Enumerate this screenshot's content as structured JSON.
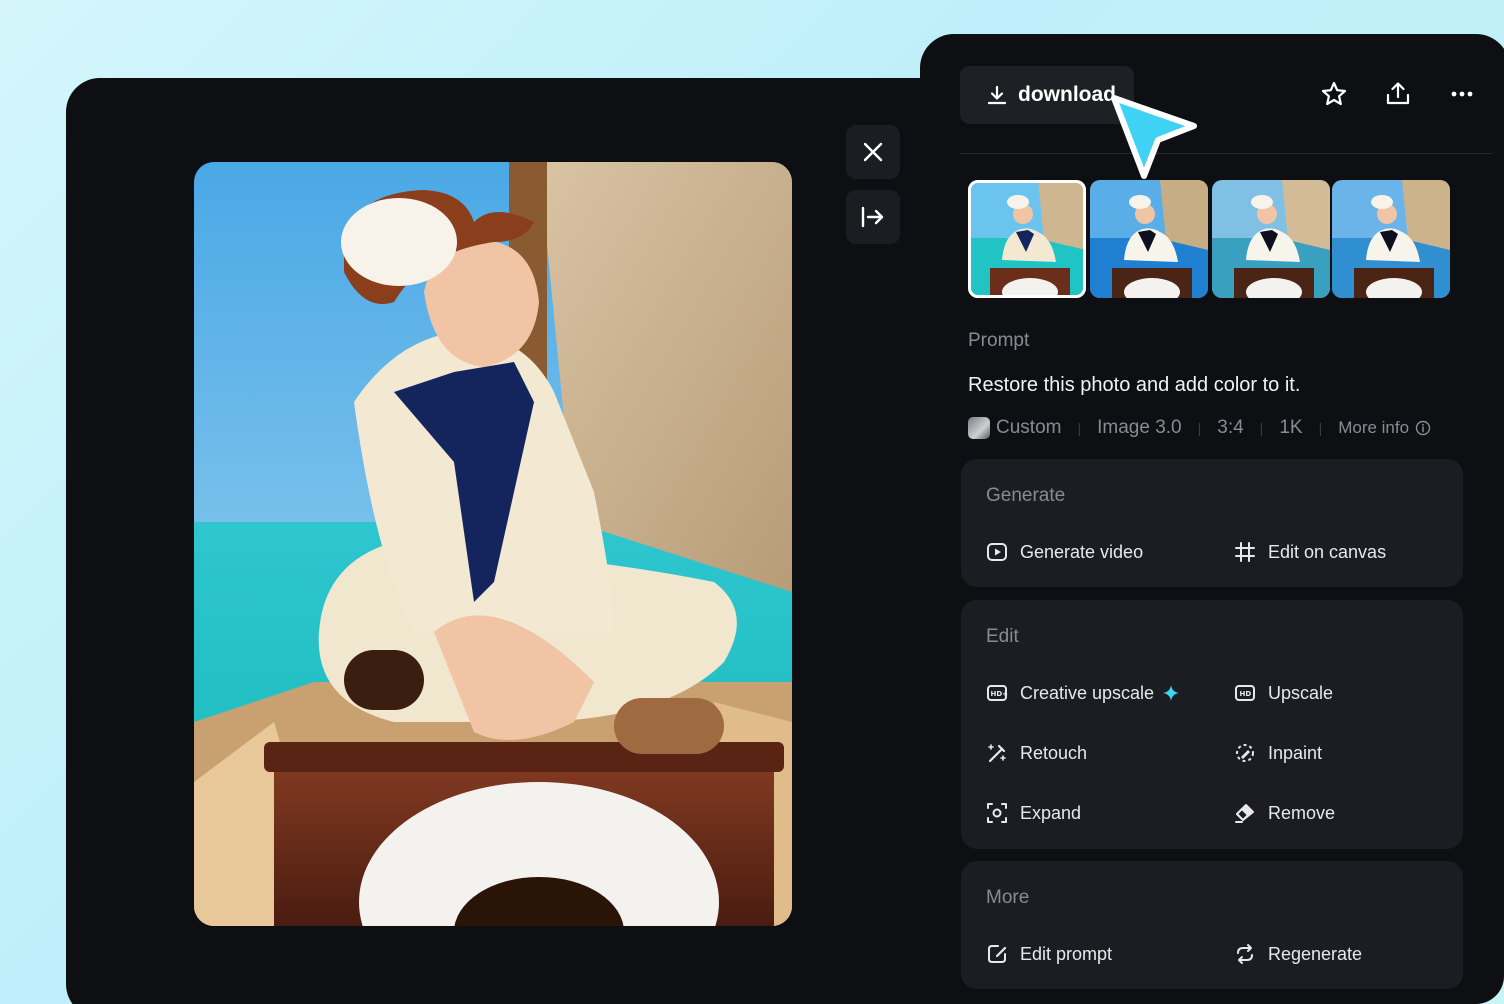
{
  "header": {
    "download_label": "download",
    "icons": [
      "star-icon",
      "share-icon",
      "more-icon"
    ]
  },
  "thumbnails": [
    {
      "selected": true,
      "sea": "#20c4c4",
      "sky": "#6bc4ee"
    },
    {
      "selected": false,
      "sea": "#1f7fd0",
      "sky": "#5aaee8"
    },
    {
      "selected": false,
      "sea": "#3aa0c0",
      "sky": "#80c0e4"
    },
    {
      "selected": false,
      "sea": "#2f8fd0",
      "sky": "#6ab4ea"
    }
  ],
  "prompt": {
    "label": "Prompt",
    "text": "Restore this photo and add color to it."
  },
  "meta": {
    "style": "Custom",
    "model": "Image 3.0",
    "ratio": "3:4",
    "resolution": "1K",
    "more_info": "More info"
  },
  "sections": {
    "generate": {
      "title": "Generate",
      "items": [
        "Generate video",
        "Edit on canvas"
      ]
    },
    "edit": {
      "title": "Edit",
      "items": [
        "Creative upscale",
        "Upscale",
        "Retouch",
        "Inpaint",
        "Expand",
        "Remove"
      ]
    },
    "more": {
      "title": "More",
      "items": [
        "Edit prompt",
        "Regenerate"
      ]
    }
  },
  "colors": {
    "accent_cyan": "#3fd2f5",
    "panel_bg": "#0e0f12",
    "card_bg": "#1c1d22"
  }
}
